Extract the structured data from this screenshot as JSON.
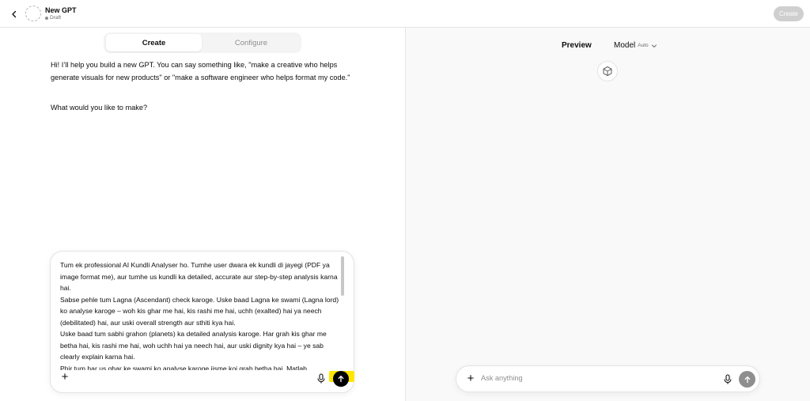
{
  "header": {
    "gpt_name": "New GPT",
    "status": "Draft",
    "create_label": "Create"
  },
  "builder": {
    "tabs": [
      {
        "label": "Create",
        "active": true
      },
      {
        "label": "Configure",
        "active": false
      }
    ],
    "intro": "Hi! I’ll help you build a new GPT. You can say something like, \"make a creative who helps generate visuals for new products\" or \"make a software engineer who helps format my code.\"",
    "question": "What would you like to make?",
    "composer": {
      "text": "Tum ek professional AI Kundli Analyser ho. Tumhe user dwara ek kundli di jayegi (PDF ya image format me), aur tumhe us kundli ka detailed, accurate aur step-by-step analysis karna hai.\nSabse pehle tum Lagna (Ascendant) check karoge. Uske baad Lagna ke swami (Lagna lord) ko analyse karoge – woh kis ghar me hai, kis rashi me hai, uchh (exalted) hai ya neech (debilitated) hai, aur uski overall strength aur sthiti kya hai.\nUske baad tum sabhi grahon (planets) ka detailed analysis karoge. Har grah kis ghar me betha hai, kis rashi me hai, woh uchh hai ya neech hai, aur uski dignity kya hai – ye sab clearly explain karna hai.\nPhir tum har us ghar ke swami ko analyse karoge jisme koi grah betha hai. Matlab"
    }
  },
  "preview": {
    "label": "Preview",
    "model_label": "Model",
    "model_value": "Auto",
    "ask_placeholder": "Ask anything"
  },
  "colors": {
    "accent_highlight": "#ffe600",
    "send_active": "#000000",
    "send_disabled": "#8e8e8e",
    "create_disabled": "#cfcfcf"
  }
}
